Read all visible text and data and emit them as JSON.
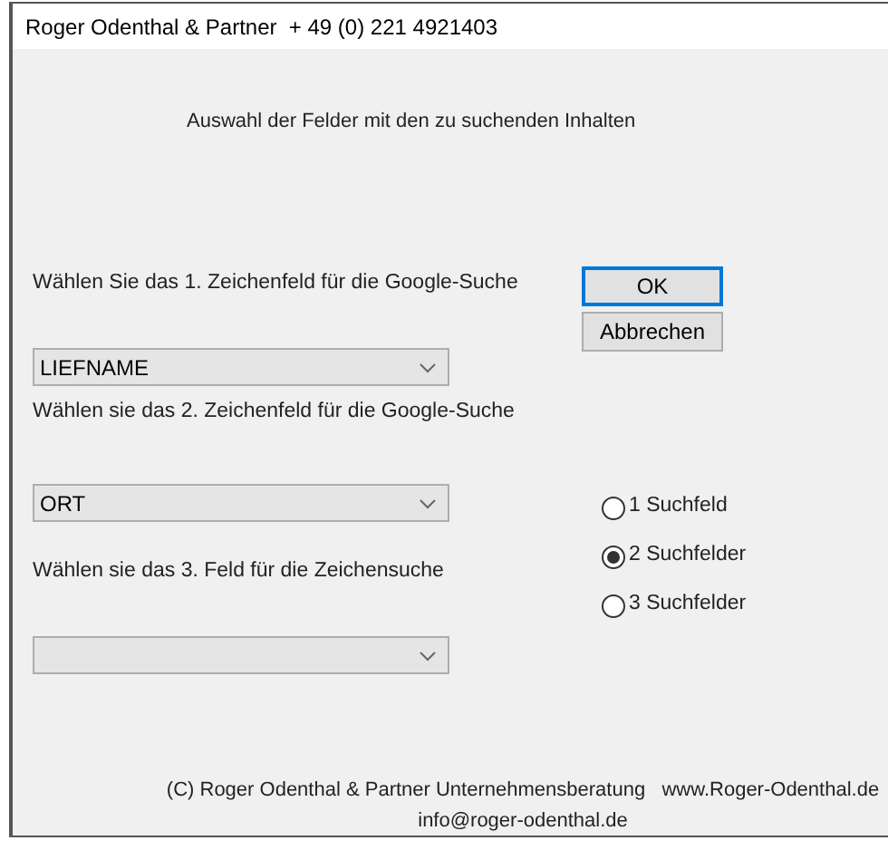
{
  "window": {
    "title": "Roger Odenthal & Partner  + 49 (0) 221 4921403"
  },
  "heading": "Auswahl der Felder mit den zu suchenden Inhalten",
  "field_labels": [
    "Wählen Sie das 1. Zeichenfeld für die Google-Suche",
    "Wählen sie das 2. Zeichenfeld für die Google-Suche",
    "Wählen sie das 3. Feld für die Zeichensuche"
  ],
  "dropdowns": [
    {
      "kind": "combo",
      "value": "LIEFNAME"
    },
    {
      "kind": "combo",
      "value": "ORT"
    },
    {
      "kind": "combo"
    }
  ],
  "buttons": [
    {
      "label": "OK",
      "kind": "default"
    },
    {
      "label": "Abbrechen",
      "kind": "normal"
    }
  ],
  "search_count": [
    {
      "label": "1 Suchfeld",
      "selected": false
    },
    {
      "label": "2 Suchfelder",
      "selected": true
    },
    {
      "label": "3 Suchfelder",
      "selected": false
    }
  ],
  "footer": {
    "copyright": "(C) Roger Odenthal & Partner Unternehmensberatung   www.Roger-Odenthal.de",
    "email": "info@roger-odenthal.de"
  }
}
